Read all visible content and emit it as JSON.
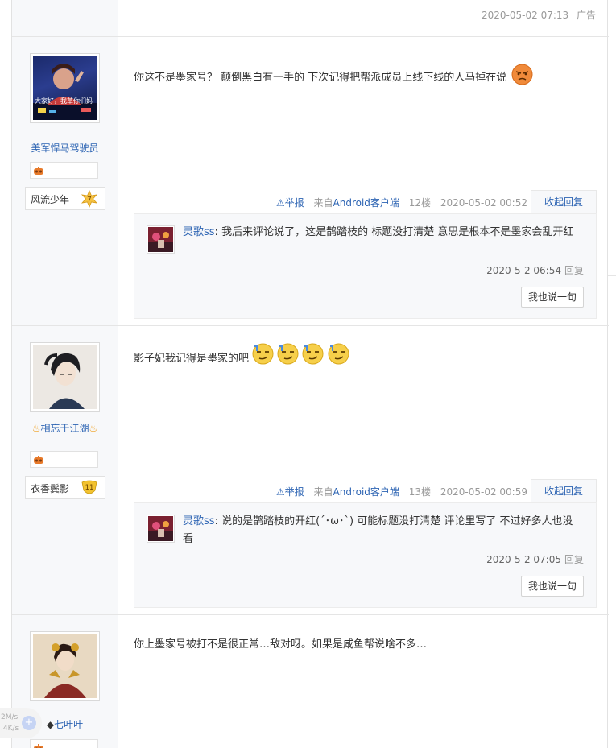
{
  "prev_post": {
    "timestamp": "2020-05-02 07:13",
    "ad_label": "广告"
  },
  "posts": [
    {
      "user": {
        "name": "美军悍马驾驶员",
        "level_name": "风流少年",
        "level_num": "7",
        "avatar_caption": "大家好，我草你们妈"
      },
      "content": "你这不是墨家号？ 颠倒黑白有一手的 下次记得把帮派成员上线下线的人马掉在说",
      "meta": {
        "report": "举报",
        "client_prefix": "来自",
        "client": "Android客户端",
        "floor": "12楼",
        "time": "2020-05-02 00:52"
      },
      "toggle": "收起回复",
      "reply": {
        "name": "灵歌ss",
        "sep": ": ",
        "text": "我后来评论说了，这是鹊踏枝的 标题没打清楚 意思是根本不是墨家会乱开红",
        "time": "2020-5-2 06:54",
        "reply_link": "回复"
      },
      "reply_button": "我也说一句"
    },
    {
      "user": {
        "name": "相忘于江湖",
        "level_name": "衣香鬓影",
        "level_num": "11"
      },
      "content": "影子妃我记得是墨家的吧",
      "meta": {
        "report": "举报",
        "client_prefix": "来自",
        "client": "Android客户端",
        "floor": "13楼",
        "time": "2020-05-02 00:59"
      },
      "toggle": "收起回复",
      "reply": {
        "name": "灵歌ss",
        "sep": ": ",
        "text": "说的是鹊踏枝的开红(´･ω･`) 可能标题没打清楚 评论里写了 不过好多人也没看",
        "time": "2020-5-2 07:05",
        "reply_link": "回复"
      },
      "reply_button": "我也说一句"
    },
    {
      "user": {
        "name": "七叶叶",
        "name_prefix": "◆"
      },
      "content": "你上墨家号被打不是很正常…敌对呀。如果是咸鱼帮说啥不多…"
    }
  ],
  "net_widget": {
    "up": "2M/s",
    "down": ".4K/s",
    "plus": "+"
  },
  "colors": {
    "link": "#2d64b3",
    "muted": "#999999",
    "panel": "#f7f8fa",
    "level7": "#f5c242",
    "level11": "#f2c230"
  }
}
